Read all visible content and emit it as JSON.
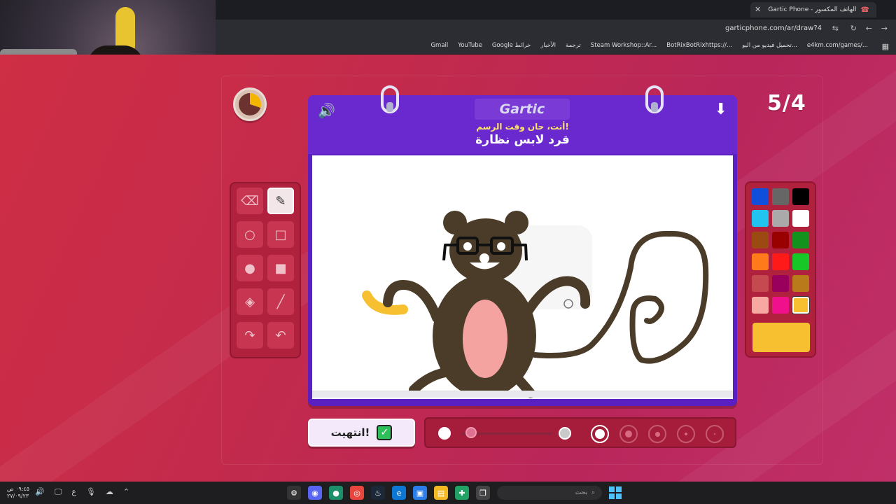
{
  "browser": {
    "tab_title": "Gartic Phone - الهاتف المكسور",
    "url": "garticphone.com/ar/draw?4",
    "bookmarks": [
      "Gmail",
      "YouTube",
      "Google خرائط",
      "الأخبار",
      "ترجمة",
      "Steam Workshop::Ar...",
      "BotRixBotRixhttps://...",
      "تحميل فيديو من اليو...",
      "e4km.com/games/..."
    ]
  },
  "game": {
    "logo": "Gartic",
    "prompt_subtitle": "أنت، حان وقت الرسم!",
    "prompt_word": "قرد لابس نظارة",
    "round": "5/4",
    "timer_fraction": 0.3,
    "done_label": "انتهيت!"
  },
  "tools": [
    {
      "name": "eraser-tool",
      "icon": "⌫"
    },
    {
      "name": "pencil-tool",
      "icon": "✎",
      "active": true
    },
    {
      "name": "ellipse-outline-tool",
      "icon": "○"
    },
    {
      "name": "rectangle-outline-tool",
      "icon": "□"
    },
    {
      "name": "ellipse-fill-tool",
      "icon": "●"
    },
    {
      "name": "rectangle-fill-tool",
      "icon": "■"
    },
    {
      "name": "fill-bucket-tool",
      "icon": "◈"
    },
    {
      "name": "line-tool",
      "icon": "╱"
    },
    {
      "name": "redo-tool",
      "icon": "↷"
    },
    {
      "name": "undo-tool",
      "icon": "↶"
    }
  ],
  "palette": {
    "colors": [
      "#0f4fd9",
      "#666666",
      "#000000",
      "#20c4ee",
      "#aaaaaa",
      "#ffffff",
      "#9b4a12",
      "#990000",
      "#14921e",
      "#ff7a1a",
      "#ff1a1a",
      "#17c727",
      "#c44a50",
      "#99005e",
      "#b87a1a",
      "#f7a8a0",
      "#f0108c",
      "#f7c030"
    ],
    "selected_index": 17,
    "current_color": "#f7c030"
  },
  "controls": {
    "opacity_fraction": 0.1,
    "brush_sizes_count": 5,
    "selected_size_index": 0
  },
  "taskbar": {
    "clock_time": "٠٩:٤٥ ص",
    "clock_date": "٢٧/٠٩/٢٣",
    "search_placeholder": "بحث"
  }
}
